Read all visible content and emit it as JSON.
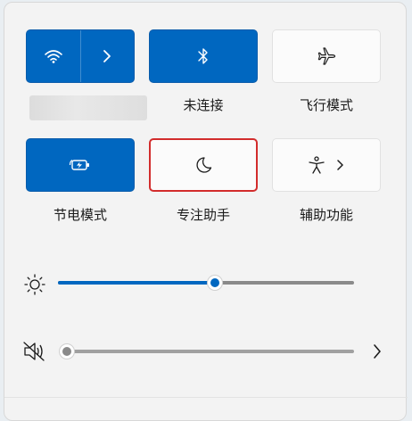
{
  "quick_settings": {
    "tiles": [
      {
        "id": "wifi",
        "label": "",
        "state": "on",
        "icon": "wifi-icon"
      },
      {
        "id": "bluetooth",
        "label": "未连接",
        "state": "on",
        "icon": "bluetooth-icon"
      },
      {
        "id": "airplane",
        "label": "飞行模式",
        "state": "off",
        "icon": "airplane-icon"
      },
      {
        "id": "battery_saver",
        "label": "节电模式",
        "state": "on",
        "icon": "battery-saver-icon"
      },
      {
        "id": "focus_assist",
        "label": "专注助手",
        "state": "off",
        "icon": "moon-icon"
      },
      {
        "id": "accessibility",
        "label": "辅助功能",
        "state": "off",
        "icon": "accessibility-icon"
      }
    ]
  },
  "brightness": {
    "icon": "sun-icon",
    "level": 0.53
  },
  "volume": {
    "icon": "speaker-muted-icon",
    "level": 0.0,
    "muted": true,
    "more_icon": "chevron-right-icon"
  },
  "colors": {
    "accent": "#0067c0",
    "focus_outline": "#d22c2c",
    "tile_off": "#fbfbfb",
    "panel": "#f3f3f3"
  }
}
